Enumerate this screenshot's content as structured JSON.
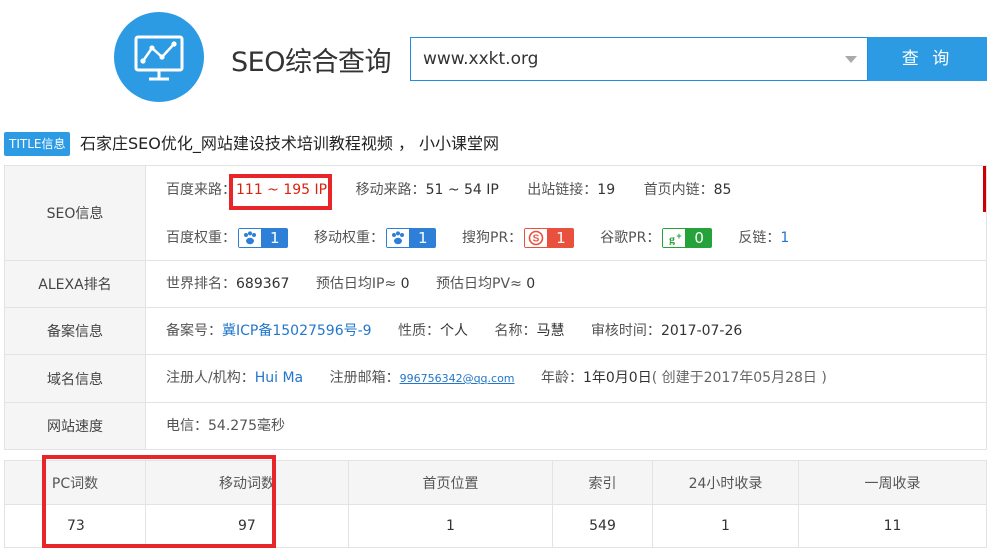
{
  "brand": {
    "title": "SEO综合查询"
  },
  "search": {
    "value": "www.xxkt.org",
    "button_label": "查 询"
  },
  "title_info": {
    "badge": "TITLE信息",
    "text": "石家庄SEO优化_网站建设技术培训教程视频 ， 小小课堂网"
  },
  "seo": {
    "label": "SEO信息",
    "baidu_traffic_label": "百度来路：",
    "baidu_traffic_value": "111 ~ 195 IP",
    "mobile_traffic_label": "移动来路：",
    "mobile_traffic_value": "51 ~ 54 IP",
    "outbound_label": "出站链接：",
    "outbound_value": "19",
    "homepage_links_label": "首页内链：",
    "homepage_links_value": "85",
    "baidu_weight_label": "百度权重：",
    "baidu_weight_value": "1",
    "mobile_weight_label": "移动权重：",
    "mobile_weight_value": "1",
    "sogou_pr_label": "搜狗PR：",
    "sogou_pr_value": "1",
    "google_pr_label": "谷歌PR：",
    "google_pr_value": "0",
    "backlinks_label": "反链：",
    "backlinks_value": "1"
  },
  "alexa": {
    "label": "ALEXA排名",
    "world_rank_label": "世界排名：",
    "world_rank_value": "689367",
    "daily_ip_label": "预估日均IP≈",
    "daily_ip_value": "0",
    "daily_pv_label": "预估日均PV≈",
    "daily_pv_value": "0"
  },
  "icp": {
    "label": "备案信息",
    "number_label": "备案号：",
    "number_value": "冀ICP备15027596号-9",
    "nature_label": "性质：",
    "nature_value": "个人",
    "name_label": "名称：",
    "name_value": "马慧",
    "audit_label": "审核时间：",
    "audit_value": "2017-07-26"
  },
  "domain": {
    "label": "域名信息",
    "registrant_label": "注册人/机构：",
    "registrant_value": "Hui Ma",
    "email_label": "注册邮箱：",
    "email_value": "996756342@qq.com",
    "age_label": "年龄：",
    "age_value": "1年0月0日",
    "created_value": "( 创建于2017年05月28日 )"
  },
  "speed": {
    "label": "网站速度",
    "value": "电信：54.275毫秒"
  },
  "stats": {
    "headers": [
      "PC词数",
      "移动词数",
      "首页位置",
      "索引",
      "24小时收录",
      "一周收录"
    ],
    "values": [
      "73",
      "97",
      "1",
      "549",
      "1",
      "11"
    ]
  },
  "colors": {
    "accent": "#2d9be4",
    "highlight": "#e8262a",
    "link": "#2277cc",
    "red_text": "#d9230f"
  }
}
